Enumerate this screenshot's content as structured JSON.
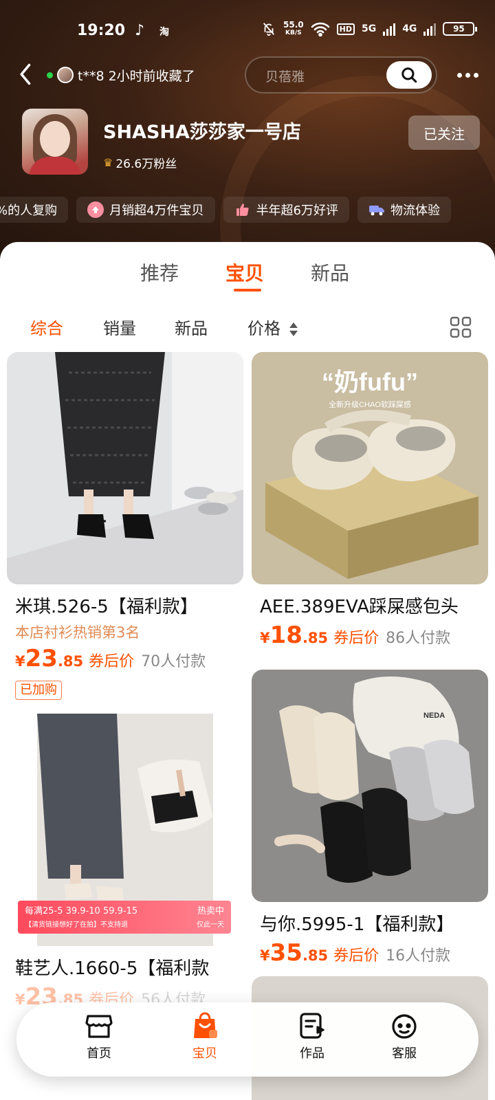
{
  "status_bar": {
    "time": "19:20",
    "app_indicator": "淘",
    "net_speed_value": "55.0",
    "net_speed_unit": "KB/S",
    "hd_label": "HD",
    "net1_label": "5G",
    "net2_label": "4G",
    "battery": "95"
  },
  "top_nav": {
    "visitor_text": "t**8 2小时前收藏了",
    "search_placeholder": "贝蓓雅"
  },
  "shop": {
    "name": "SHASHA莎莎家一号店",
    "fans": "26.6万粉丝",
    "follow_label": "已关注"
  },
  "badges": [
    {
      "label": "%的人复购",
      "icon": "repeat-icon"
    },
    {
      "label": "月销超4万件宝贝",
      "icon": "arrow-up-icon",
      "color": "#ff6b6b"
    },
    {
      "label": "半年超6万好评",
      "icon": "thumb-up-icon",
      "color": "#ff7a8a"
    },
    {
      "label": "物流体验",
      "icon": "truck-icon",
      "color": "#7b8cff"
    }
  ],
  "tabs": [
    {
      "label": "推荐"
    },
    {
      "label": "宝贝",
      "active": true
    },
    {
      "label": "新品"
    }
  ],
  "sort": {
    "items": [
      "综合",
      "销量",
      "新品",
      "价格"
    ],
    "active": "综合"
  },
  "products": [
    {
      "title": "米琪.526-5【福利款】",
      "subtitle": "本店衬衫热销第3名",
      "yen": "¥",
      "price_int": "23",
      "price_dec": ".85",
      "price_label": "券后价",
      "paid": "70人付款",
      "tag": "已加购"
    },
    {
      "title": "AEE.389EVA踩屎感包头",
      "yen": "¥",
      "price_int": "18",
      "price_dec": ".85",
      "price_label": "券后价",
      "paid": "86人付款",
      "image_text_main": "“奶fufu”",
      "image_text_sub": "全新升级CHAO软踩屎感"
    },
    {
      "title": "鞋艺人.1660-5【福利款",
      "yen": "¥",
      "price_int": "23",
      "price_dec": ".85",
      "price_label": "券后价",
      "paid": "56人付款",
      "promo_line1": "每满25-5  39.9-10  59.9-15",
      "promo_line2": "【清货链接想好了在拍】不支持退",
      "promo_badge": "热卖中",
      "promo_badge2": "仅此一天"
    },
    {
      "title": "与你.5995-1【福利款】",
      "yen": "¥",
      "price_int": "35",
      "price_dec": ".85",
      "price_label": "券后价",
      "paid": "16人付款",
      "image_text_bag": "NEDA"
    }
  ],
  "bottom_nav": [
    {
      "label": "首页",
      "icon": "shop-home-icon"
    },
    {
      "label": "宝贝",
      "icon": "bag-icon",
      "active": true
    },
    {
      "label": "作品",
      "icon": "works-icon"
    },
    {
      "label": "客服",
      "icon": "service-icon"
    }
  ],
  "colors": {
    "accent": "#ff5000",
    "header_dark": "#2b170d"
  }
}
